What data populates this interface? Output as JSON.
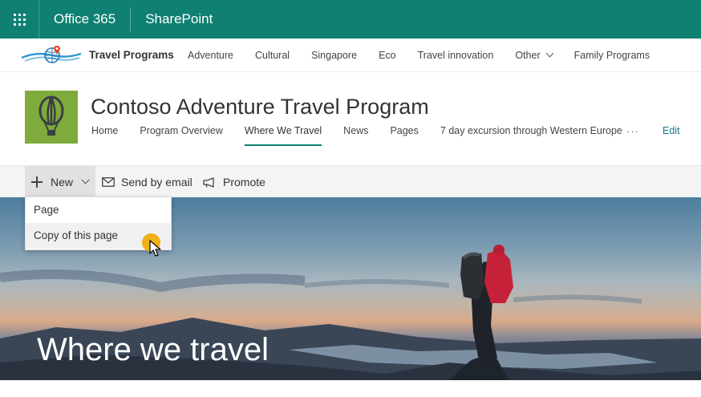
{
  "suite_bar": {
    "app_name": "Office 365",
    "product_name": "SharePoint",
    "bg_color": "#0f8072",
    "waffle_icon": "app-launcher-icon"
  },
  "hub_nav": {
    "title": "Travel Programs",
    "links": [
      "Adventure",
      "Cultural",
      "Singapore",
      "Eco",
      "Travel innovation",
      "Other",
      "Family Programs"
    ],
    "logo_icon": "globe-location-icon"
  },
  "site_header": {
    "title": "Contoso Adventure Travel Program",
    "logo_icon": "hot-air-balloon-icon",
    "nav": [
      "Home",
      "Program Overview",
      "Where We Travel",
      "News",
      "Pages",
      "7 day excursion through Western Europe"
    ],
    "active_nav": "Where We Travel",
    "more_label": "···",
    "edit_label": "Edit"
  },
  "command_bar": {
    "new_label": "New",
    "send_label": "Send by email",
    "promote_label": "Promote"
  },
  "new_menu": {
    "items": [
      "Page",
      "Copy of this page"
    ],
    "hovered": "Copy of this page"
  },
  "hero": {
    "title": "Where we travel"
  }
}
